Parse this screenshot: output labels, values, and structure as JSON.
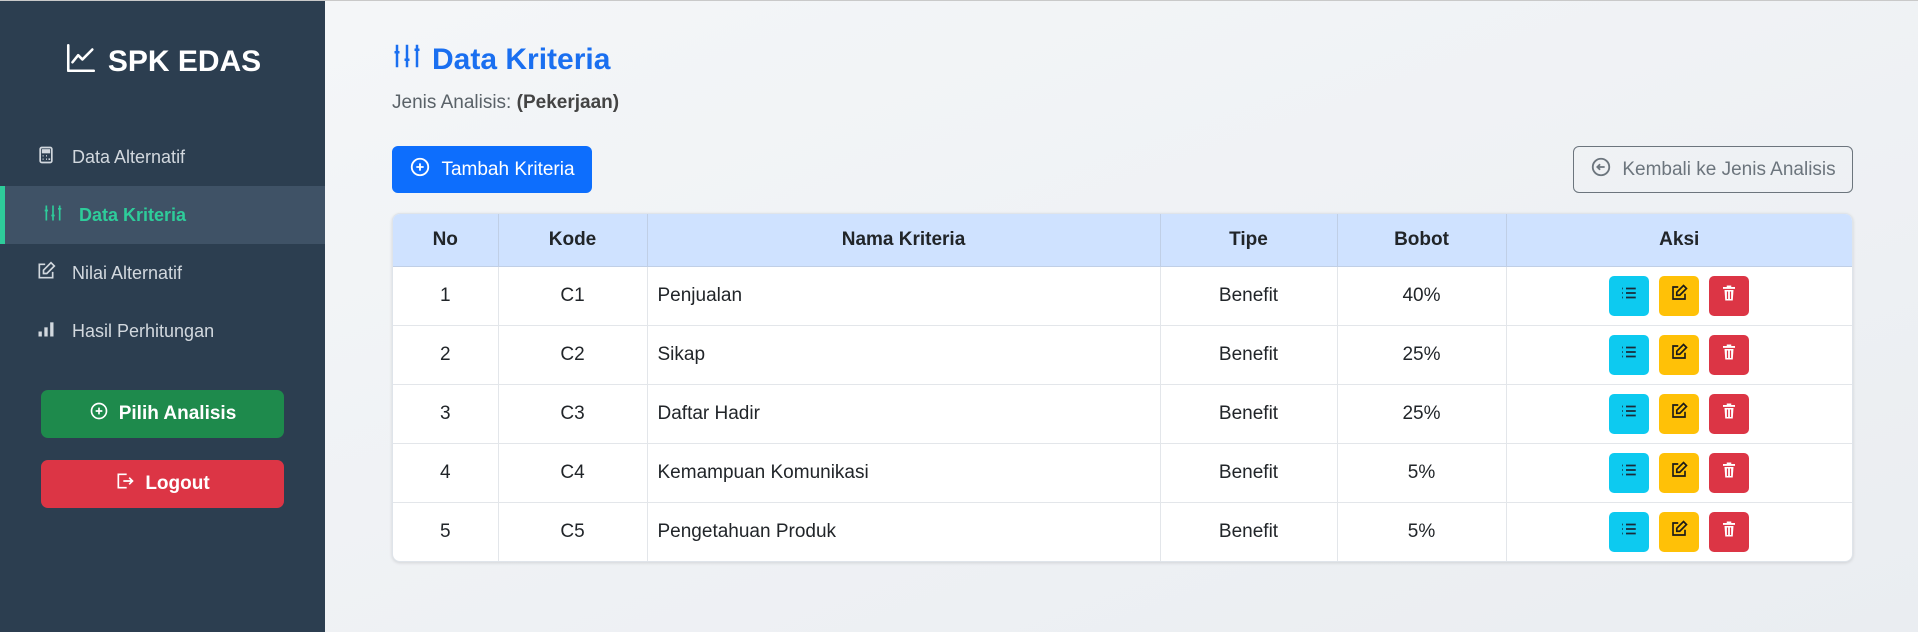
{
  "sidebar": {
    "brand": "SPK EDAS",
    "items": [
      {
        "label": "Data Alternatif",
        "icon": "calculator-icon",
        "active": false
      },
      {
        "label": "Data Kriteria",
        "icon": "sliders-icon",
        "active": true
      },
      {
        "label": "Nilai Alternatif",
        "icon": "edit-icon",
        "active": false
      },
      {
        "label": "Hasil Perhitungan",
        "icon": "bar-chart-icon",
        "active": false
      }
    ],
    "pilih_label": "Pilih Analisis",
    "logout_label": "Logout"
  },
  "main": {
    "title": "Data Kriteria",
    "subtitle_prefix": "Jenis Analisis: ",
    "subtitle_value": "(Pekerjaan)",
    "add_label": "Tambah Kriteria",
    "back_label": "Kembali ke Jenis Analisis"
  },
  "table": {
    "headers": [
      "No",
      "Kode",
      "Nama Kriteria",
      "Tipe",
      "Bobot",
      "Aksi"
    ],
    "rows": [
      {
        "no": "1",
        "kode": "C1",
        "nama": "Penjualan",
        "tipe": "Benefit",
        "bobot": "40%"
      },
      {
        "no": "2",
        "kode": "C2",
        "nama": "Sikap",
        "tipe": "Benefit",
        "bobot": "25%"
      },
      {
        "no": "3",
        "kode": "C3",
        "nama": "Daftar Hadir",
        "tipe": "Benefit",
        "bobot": "25%"
      },
      {
        "no": "4",
        "kode": "C4",
        "nama": "Kemampuan Komunikasi",
        "tipe": "Benefit",
        "bobot": "5%"
      },
      {
        "no": "5",
        "kode": "C5",
        "nama": "Pengetahuan Produk",
        "tipe": "Benefit",
        "bobot": "5%"
      }
    ]
  },
  "colors": {
    "sidebar_bg": "#2c3e50",
    "active_accent": "#2ecc9a",
    "primary": "#0d6efd",
    "title": "#1a6ff0",
    "success": "#1e8a4c",
    "danger": "#dc3545",
    "info": "#0dcaf0",
    "warning": "#ffc107",
    "table_header": "#cfe2ff"
  }
}
